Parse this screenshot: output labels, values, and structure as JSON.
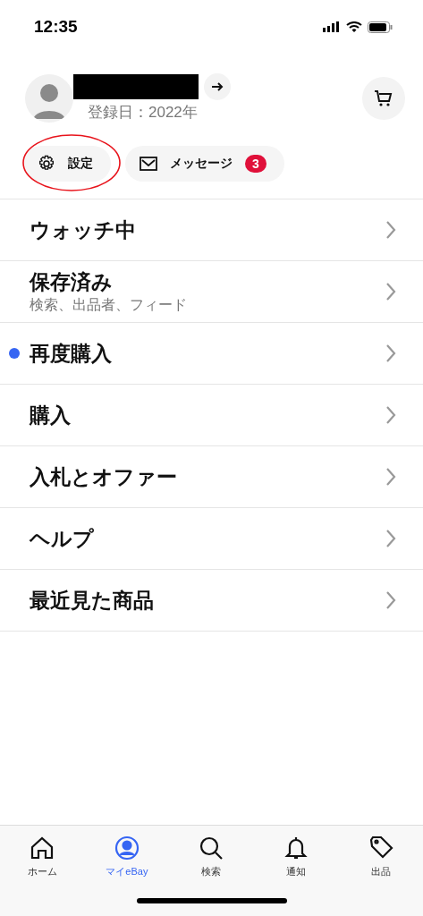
{
  "status_bar": {
    "time": "12:35"
  },
  "profile": {
    "registered": "登録日：2022年"
  },
  "chips": [
    {
      "kind": "settings",
      "label": "設定",
      "circled": true
    },
    {
      "kind": "messages",
      "label": "メッセージ",
      "badge": "3",
      "circled": false
    }
  ],
  "menu": [
    {
      "label": "ウォッチ中",
      "unread": false
    },
    {
      "label": "保存済み",
      "subtitle": "検索、出品者、フィード",
      "unread": false
    },
    {
      "label": "再度購入",
      "unread": true
    },
    {
      "label": "購入",
      "unread": false
    },
    {
      "label": "入札とオファー",
      "unread": false
    },
    {
      "label": "ヘルプ",
      "unread": false
    },
    {
      "label": "最近見た商品",
      "unread": false
    }
  ],
  "tab_bar": [
    {
      "kind": "home",
      "label": "ホーム",
      "selected": false
    },
    {
      "kind": "account",
      "label": "マイeBay",
      "selected": true
    },
    {
      "kind": "search",
      "label": "検索",
      "selected": false
    },
    {
      "kind": "bell",
      "label": "通知",
      "selected": false
    },
    {
      "kind": "tag",
      "label": "出品",
      "selected": false
    }
  ]
}
